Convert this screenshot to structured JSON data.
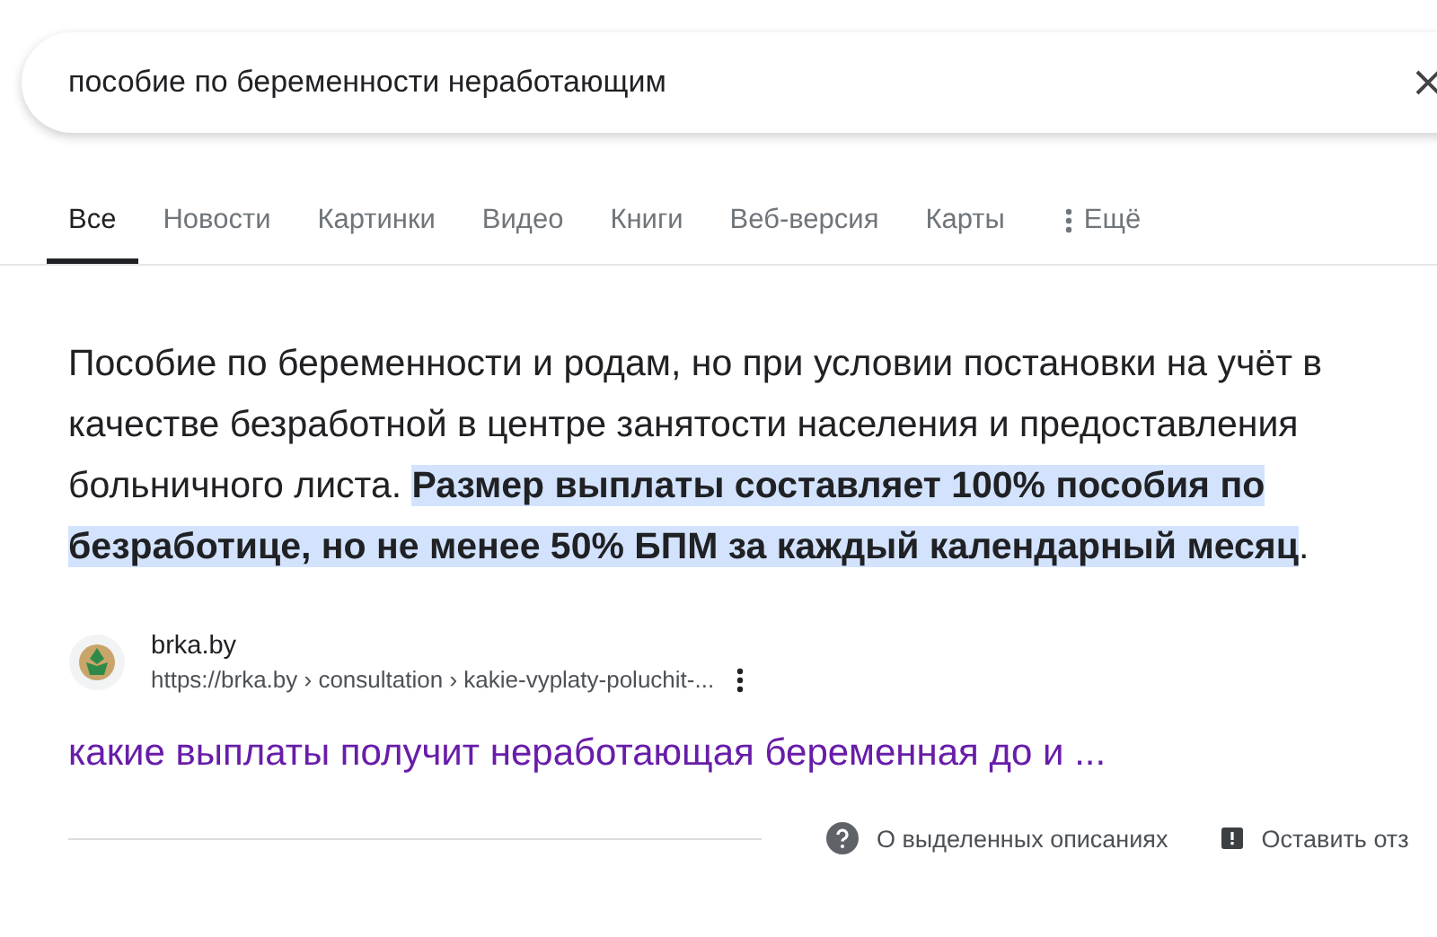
{
  "search": {
    "value": "пособие по беременности неработающим"
  },
  "tabs": [
    {
      "label": "Все",
      "selected": true
    },
    {
      "label": "Новости",
      "selected": false
    },
    {
      "label": "Картинки",
      "selected": false
    },
    {
      "label": "Видео",
      "selected": false
    },
    {
      "label": "Книги",
      "selected": false
    },
    {
      "label": "Веб-версия",
      "selected": false
    },
    {
      "label": "Карты",
      "selected": false
    }
  ],
  "more_tab": {
    "label": "Ещё"
  },
  "snippet": {
    "text": "Пособие по беременности и родам, но при условии постановки на учёт в качестве безработной в центре занятости населения и предоставления больничного листа. **Размер выплаты составляет 100% пособия по безработице, но не менее 50% БПМ за каждый календарный месяц**."
  },
  "source": {
    "site": "brka.by",
    "url": "https://brka.by › consultation › kakie-vyplaty-poluchit-..."
  },
  "result_title": "какие выплаты получит неработающая беременная до и ...",
  "footer": {
    "about": "О выделенных описаниях",
    "feedback": "Оставить отз"
  }
}
